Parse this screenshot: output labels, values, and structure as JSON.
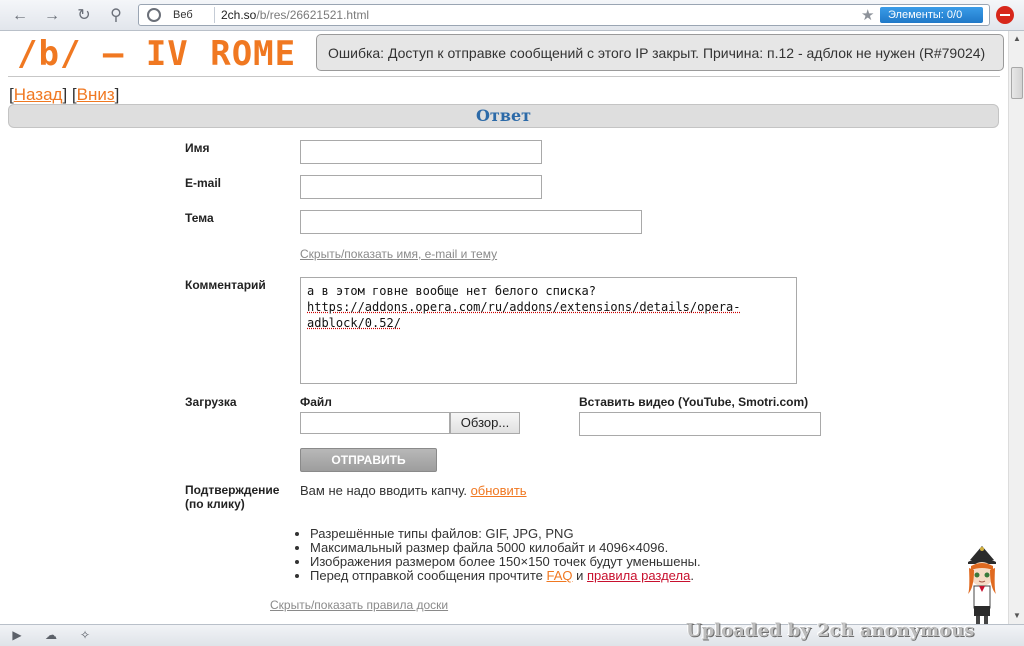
{
  "browser": {
    "back_icon": "arrow-left-icon",
    "forward_icon": "arrow-right-icon",
    "reload_icon": "reload-icon",
    "key_icon": "key-icon",
    "web_label": "Веб",
    "url_host": "2ch.so",
    "url_path": "/b/res/26621521.html",
    "elements_label": "Элементы:  0/0"
  },
  "page": {
    "board_title": "/b/ – IV ROME",
    "error_message": "Ошибка: Доступ к отправке сообщений с этого IP закрыт. Причина: п.12 - адблок не нужен (R#79024)",
    "nav": {
      "back": "Назад",
      "down": "Вниз"
    },
    "reply_header": "Ответ"
  },
  "form": {
    "name_label": "Имя",
    "email_label": "E-mail",
    "subject_label": "Тема",
    "toggle_fields": "Скрыть/показать имя, e-mail и тему",
    "comment_label": "Комментарий",
    "comment_line1": "а в этом говне вообще нет белого списка?",
    "comment_link": "https://addons.opera.com/ru/addons/extensions/details/opera-adblock/0.52/",
    "upload_label": "Загрузка",
    "file_label": "Файл",
    "browse_button": "Обзор...",
    "video_label": "Вставить видео (YouTube, Smotri.com)",
    "submit_button": "ОТПРАВИТЬ",
    "captcha_label_line1": "Подтверждение",
    "captcha_label_line2": "(по клику)",
    "captcha_text": "Вам не надо вводить капчу.",
    "captcha_refresh": "обновить",
    "rules": {
      "types": "Разрешённые типы файлов: GIF, JPG, PNG",
      "max_size": "Максимальный размер файла 5000 килобайт и 4096×4096.",
      "resize": "Изображения размером более 150×150 точек будут уменьшены.",
      "before_post": "Перед отправкой сообщения прочтите",
      "faq": "FAQ",
      "and": "и",
      "board_rules": "правила раздела",
      "dot": "."
    },
    "toggle_rules": "Скрыть/показать правила доски"
  },
  "watermark": {
    "prefix": "Uploaded by ",
    "brand": "2ch",
    "suffix": " anonymous"
  },
  "status_bar": {
    "icons": [
      "panel-icon",
      "cloud-icon",
      "share-icon"
    ]
  }
}
